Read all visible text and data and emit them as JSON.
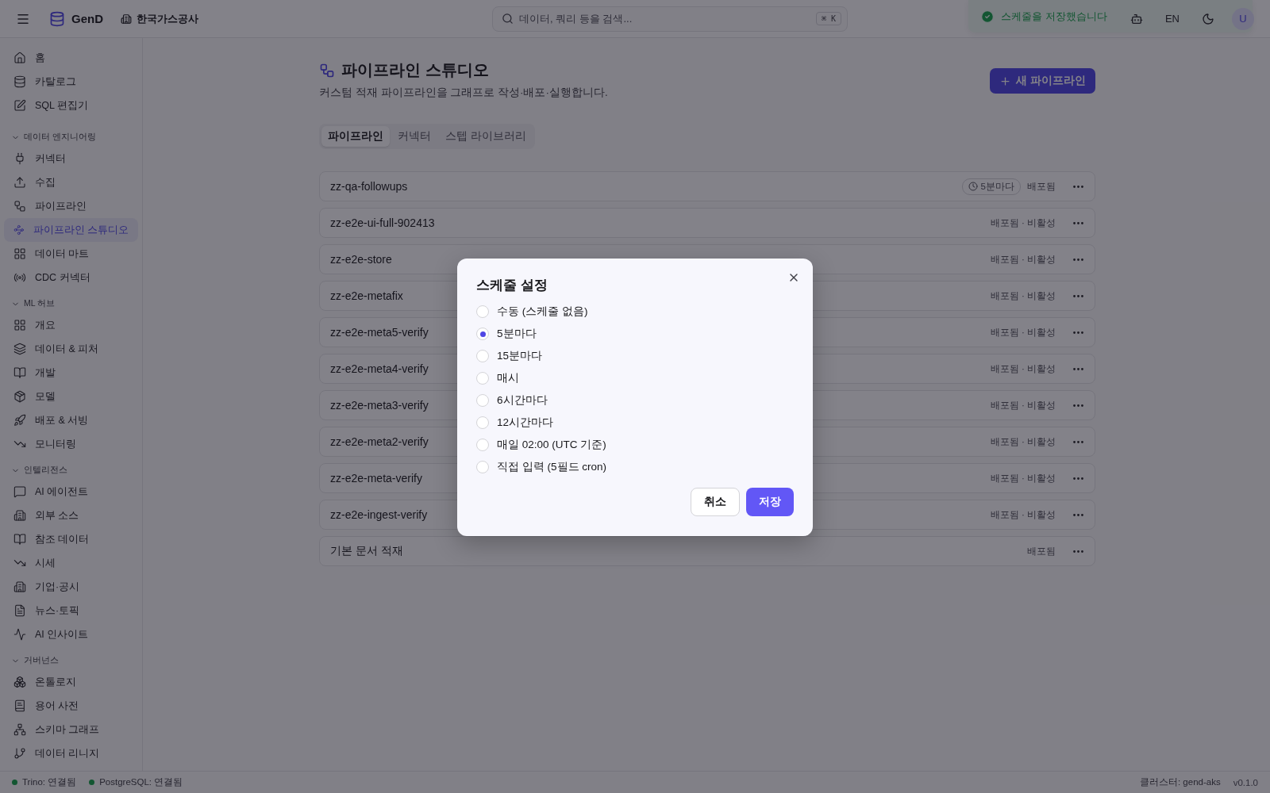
{
  "header": {
    "logo": "GenD",
    "org": "한국가스공사",
    "search": {
      "placeholder": "데이터, 쿼리 등을 검색...",
      "shortcut": "⌘ K"
    },
    "language": "EN",
    "avatar": "U"
  },
  "toast": {
    "message": "스케줄을 저장했습니다"
  },
  "sidebar": {
    "items": [
      {
        "label": "홈",
        "selected": false
      },
      {
        "label": "카탈로그",
        "selected": false
      },
      {
        "label": "SQL 편집기",
        "selected": false
      }
    ],
    "sections": [
      {
        "title": "데이터 엔지니어링",
        "expanded": true,
        "items": [
          {
            "label": "커넥터",
            "selected": false
          },
          {
            "label": "수집",
            "selected": false
          },
          {
            "label": "파이프라인",
            "selected": false
          },
          {
            "label": "파이프라인 스튜디오",
            "selected": true
          },
          {
            "label": "데이터 마트",
            "selected": false
          },
          {
            "label": "CDC 커넥터",
            "selected": false
          }
        ]
      },
      {
        "title": "ML 허브",
        "expanded": true,
        "items": [
          {
            "label": "개요",
            "selected": false
          },
          {
            "label": "데이터 & 피처",
            "selected": false
          },
          {
            "label": "개발",
            "selected": false
          },
          {
            "label": "모델",
            "selected": false
          },
          {
            "label": "배포 & 서빙",
            "selected": false
          },
          {
            "label": "모니터링",
            "selected": false
          }
        ]
      },
      {
        "title": "인텔리전스",
        "expanded": true,
        "items": [
          {
            "label": "AI 에이전트",
            "selected": false
          },
          {
            "label": "외부 소스",
            "selected": false
          },
          {
            "label": "참조 데이터",
            "selected": false
          },
          {
            "label": "시세",
            "selected": false
          },
          {
            "label": "기업·공시",
            "selected": false
          },
          {
            "label": "뉴스·토픽",
            "selected": false
          },
          {
            "label": "AI 인사이트",
            "selected": false
          }
        ]
      },
      {
        "title": "거버넌스",
        "expanded": true,
        "items": [
          {
            "label": "온톨로지",
            "selected": false
          },
          {
            "label": "용어 사전",
            "selected": false
          },
          {
            "label": "스키마 그래프",
            "selected": false
          },
          {
            "label": "데이터 리니지",
            "selected": false
          }
        ]
      }
    ]
  },
  "page": {
    "title": "파이프라인 스튜디오",
    "subtitle": "커스텀 적재 파이프라인을 그래프로 작성·배포·실행합니다.",
    "new_button": "새 파이프라인",
    "tabs": [
      {
        "label": "파이프라인",
        "selected": true
      },
      {
        "label": "커넥터",
        "selected": false
      },
      {
        "label": "스텝 라이브러리",
        "selected": false
      }
    ],
    "pipelines": [
      {
        "name": "zz-qa-followups",
        "schedule": "5분마다",
        "status": "배포됨"
      },
      {
        "name": "zz-e2e-ui-full-902413",
        "status": "배포됨 · 비활성"
      },
      {
        "name": "zz-e2e-store",
        "status": "배포됨 · 비활성"
      },
      {
        "name": "zz-e2e-metafix",
        "status": "배포됨 · 비활성"
      },
      {
        "name": "zz-e2e-meta5-verify",
        "status": "배포됨 · 비활성"
      },
      {
        "name": "zz-e2e-meta4-verify",
        "status": "배포됨 · 비활성"
      },
      {
        "name": "zz-e2e-meta3-verify",
        "status": "배포됨 · 비활성"
      },
      {
        "name": "zz-e2e-meta2-verify",
        "status": "배포됨 · 비활성"
      },
      {
        "name": "zz-e2e-meta-verify",
        "status": "배포됨 · 비활성"
      },
      {
        "name": "zz-e2e-ingest-verify",
        "status": "배포됨 · 비활성"
      },
      {
        "name": "기본 문서 적재",
        "status": "배포됨"
      }
    ]
  },
  "dialog": {
    "title": "스케줄 설정",
    "options": [
      {
        "label": "수동 (스케줄 없음)",
        "selected": false
      },
      {
        "label": "5분마다",
        "selected": true
      },
      {
        "label": "15분마다",
        "selected": false
      },
      {
        "label": "매시",
        "selected": false
      },
      {
        "label": "6시간마다",
        "selected": false
      },
      {
        "label": "12시간마다",
        "selected": false
      },
      {
        "label": "매일 02:00 (UTC 기준)",
        "selected": false
      },
      {
        "label": "직접 입력 (5필드 cron)",
        "selected": false
      }
    ],
    "buttons": [
      {
        "label": "취소",
        "kind": "secondary"
      },
      {
        "label": "저장",
        "kind": "primary"
      }
    ]
  },
  "status_bar": {
    "connections": [
      {
        "label": "Trino: 연결됨"
      },
      {
        "label": "PostgreSQL: 연결됨"
      }
    ],
    "cluster": "클러스터: gend-aks",
    "version": "v0.1.0"
  }
}
